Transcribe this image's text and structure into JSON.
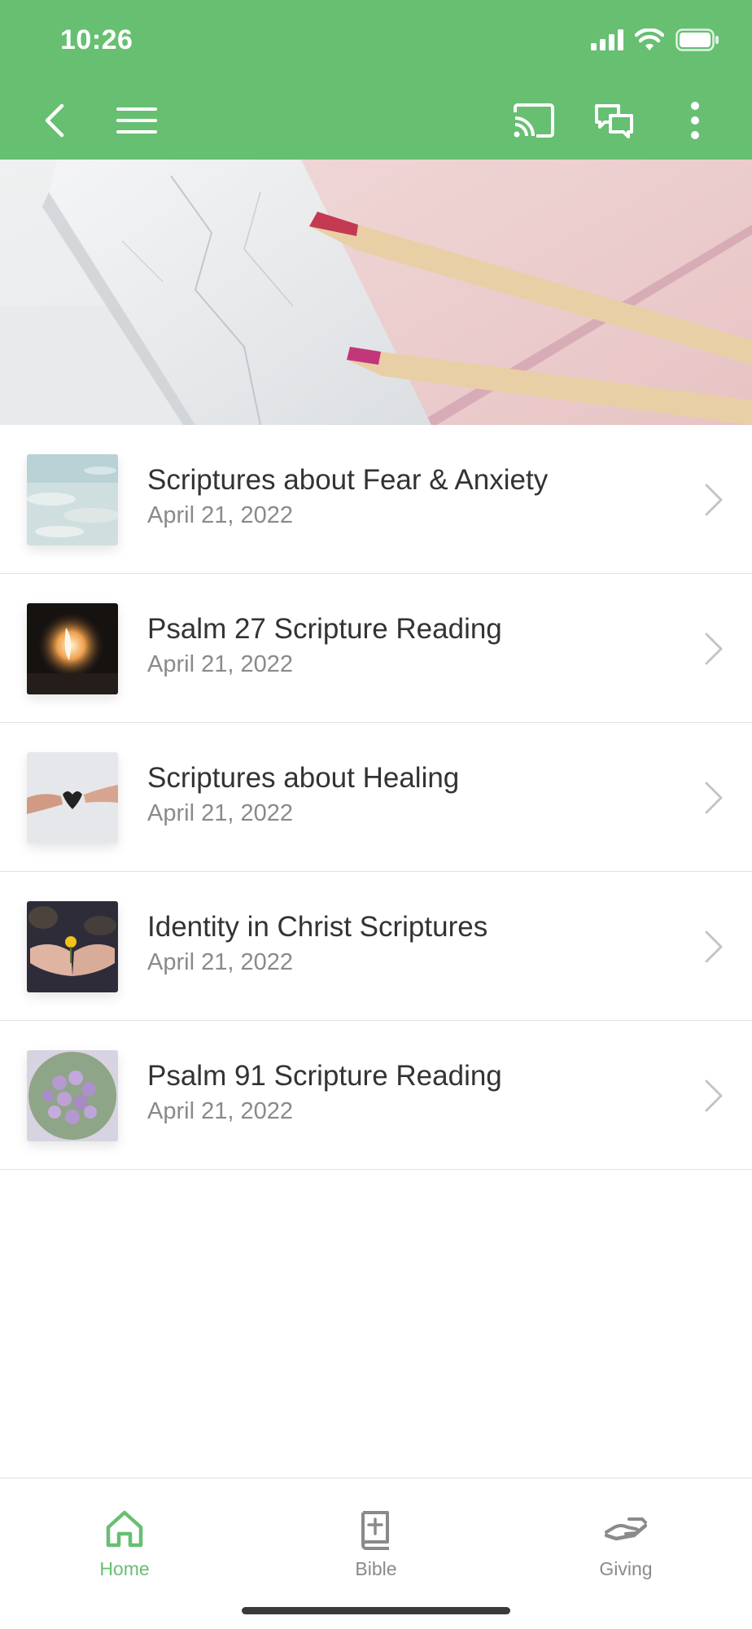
{
  "status_bar": {
    "time": "10:26",
    "icons": [
      "cellular-signal-icon",
      "wifi-icon",
      "battery-icon"
    ]
  },
  "app_bar": {
    "background_color": "#67bf72",
    "left_icons": [
      "back-arrow-icon",
      "menu-icon"
    ],
    "right_icons": [
      "cast-icon",
      "chat-icon",
      "more-vertical-icon"
    ]
  },
  "hero": {
    "image": "notebooks-and-pencils-photo"
  },
  "list": {
    "items": [
      {
        "title": "Scriptures about Fear & Anxiety",
        "date": "April 21, 2022",
        "thumbnail": "water-photo"
      },
      {
        "title": "Psalm 27 Scripture Reading",
        "date": "April 21, 2022",
        "thumbnail": "cave-light-photo"
      },
      {
        "title": "Scriptures about Healing",
        "date": "April 21, 2022",
        "thumbnail": "hands-heart-photo"
      },
      {
        "title": "Identity in Christ Scriptures",
        "date": "April 21, 2022",
        "thumbnail": "hands-flower-photo"
      },
      {
        "title": "Psalm 91 Scripture Reading",
        "date": "April 21, 2022",
        "thumbnail": "tulip-bouquet-photo"
      }
    ]
  },
  "bottom_nav": {
    "active_color": "#67bf72",
    "inactive_color": "#8a8a8a",
    "tabs": [
      {
        "label": "Home",
        "icon": "home-icon",
        "active": true
      },
      {
        "label": "Bible",
        "icon": "bible-icon",
        "active": false
      },
      {
        "label": "Giving",
        "icon": "giving-hand-icon",
        "active": false
      }
    ]
  }
}
